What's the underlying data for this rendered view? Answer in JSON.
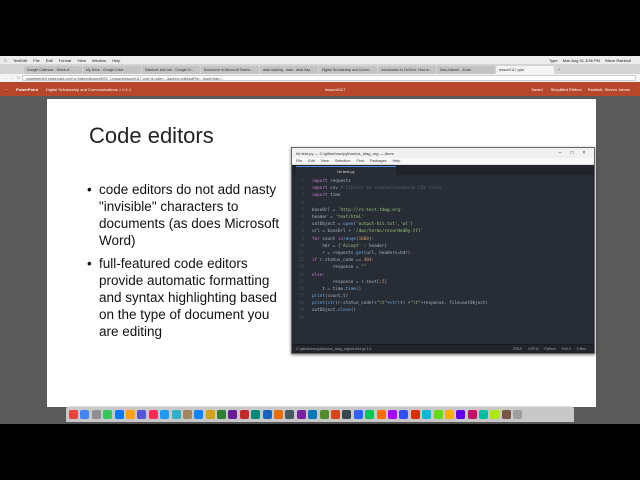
{
  "menubar": {
    "items": [
      "",
      "TextEdit",
      "File",
      "Edit",
      "Format",
      "View",
      "Window",
      "Help"
    ],
    "right": [
      "Type",
      "Mon Aug 31 3:56 PM",
      "Steve Rainbolt"
    ]
  },
  "browser": {
    "tabs": [
      "Google Calendar - Week of ...",
      "My Drive - Google Drive",
      "Rainbolt: tech lab - Google Dr...",
      "Document in Microsoft Teams...",
      "data hacking - data - what day...",
      "Digital Scholarship and Comm...",
      "Introduction to DoTech: How to...",
      "Mac Artwork - Zoom",
      "lesson0117.pptx"
    ],
    "active_tab_index": 8,
    "url": "unicefeeb3e0.sharepoint.com/:p:/r/sites/dkgrant/DSC_Lessons/lesson0117.pptx?d=w&e=...&action=edit&wdPid=...&wdOrigin=..."
  },
  "powerpoint": {
    "brand": "PowerPoint",
    "doc_title": "Digital Scholarship and Communications > 0.1.1",
    "file_name": "lesson0117",
    "saved": "Saved",
    "right_items": [
      "Simplified Ribbon",
      "Rainbolt, Steven James"
    ]
  },
  "slide": {
    "title": "Code editors",
    "bullets": [
      "code editors do not add nasty \"invisible\" characters to documents (as does Microsoft Word)",
      "full-featured code editors provide automatic formatting and syntax highlighting based on the type of document you are editing"
    ]
  },
  "atom": {
    "window_title": "hit-test.py — C:\\github\\rsc\\python\\os_tdag_org — Atom",
    "menu": [
      "File",
      "Edit",
      "View",
      "Selection",
      "Find",
      "Packages",
      "Help"
    ],
    "tab": "hit-test.py",
    "status_left": "C:\\github\\rsc\\python\\os_tdag_org\\hit-test.py  1:1",
    "status_right": [
      "CRLF",
      "UTF-8",
      "Python",
      "Pull 4",
      "0 files"
    ]
  },
  "colors": {
    "powerpoint_header": "#b7472a",
    "atom_bg": "#282c34",
    "keyword": "#c678dd",
    "string": "#98c379"
  },
  "dock_icons": [
    "#e8453c",
    "#4285f4",
    "#8e8e93",
    "#34c759",
    "#007aff",
    "#ff9f0a",
    "#5856d6",
    "#ff2d55",
    "#1d9bf0",
    "#30b0c7",
    "#a2845e",
    "#0a84ff",
    "#d4a017",
    "#2e7d32",
    "#6a1b9a",
    "#c62828",
    "#00897b",
    "#1565c0",
    "#ef6c00",
    "#455a64",
    "#7b1fa2",
    "#0277bd",
    "#558b2f",
    "#d84315",
    "#37474f",
    "#2962ff",
    "#00c853",
    "#ff6d00",
    "#aa00ff",
    "#304ffe",
    "#dd2c00",
    "#00b8d4",
    "#64dd17",
    "#ffab00",
    "#6200ea",
    "#c51162",
    "#00bfa5",
    "#aeea00",
    "#795548",
    "#9e9e9e"
  ]
}
